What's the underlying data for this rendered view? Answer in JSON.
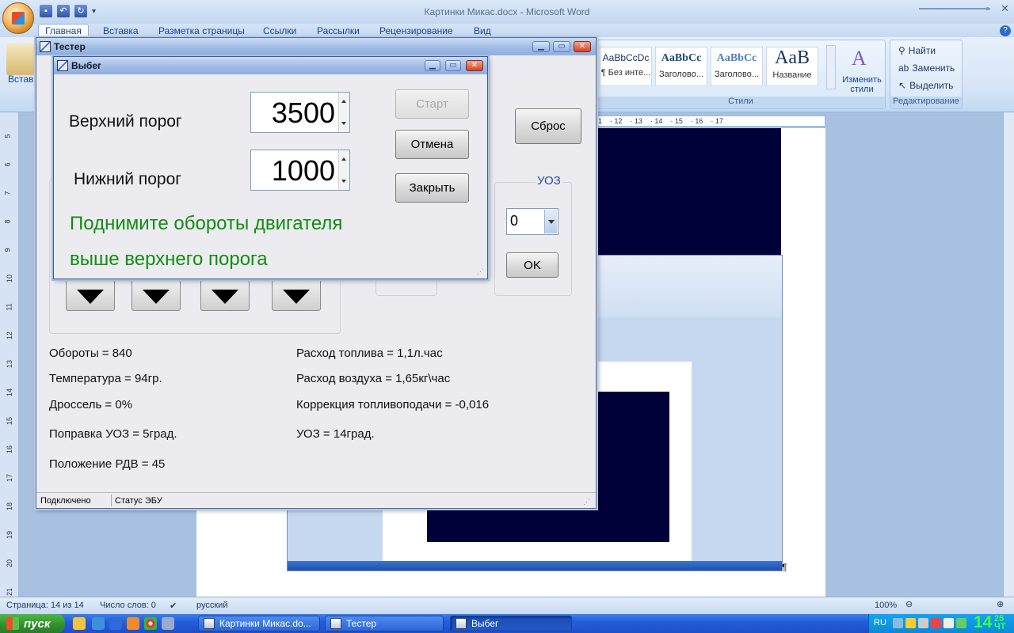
{
  "word": {
    "title": "Картинки Микас.docx - Microsoft Word",
    "tabs": [
      "Главная",
      "Вставка",
      "Разметка страницы",
      "Ссылки",
      "Рассылки",
      "Рецензирование",
      "Вид"
    ],
    "ribbon": {
      "paste_label": "Встави",
      "styles": [
        {
          "sample": "AaBbCcDc",
          "name": "¶ Без инте..."
        },
        {
          "sample": "AaBbCc",
          "name": "Заголово..."
        },
        {
          "sample": "AaBbCc",
          "name": "Заголово..."
        },
        {
          "sample": "AaB",
          "name": "Название"
        }
      ],
      "change_styles": "Изменить стили",
      "styles_group": "Стили",
      "find": "Найти",
      "replace": "Заменить",
      "select": "Выделить",
      "editing_group": "Редактирование"
    },
    "ruler": [
      "11",
      "12",
      "13",
      "14",
      "15",
      "16",
      "17"
    ],
    "vruler": [
      "5",
      "6",
      "7",
      "8",
      "9",
      "10",
      "11",
      "12",
      "13",
      "14",
      "15",
      "16",
      "17",
      "18",
      "19",
      "20",
      "21"
    ],
    "status": {
      "page": "Страница: 14 из 14",
      "words": "Число слов: 0",
      "lang": "русский",
      "zoom": "100%"
    }
  },
  "taskbar": {
    "start": "пуск",
    "items": [
      {
        "label": "Картинки Микас.do...",
        "active": false
      },
      {
        "label": "Тестер",
        "active": false
      },
      {
        "label": "Выбег",
        "active": true
      }
    ],
    "tray_lang": "RU",
    "clock_hour": "14",
    "clock_min": "25",
    "clock_day": "ЧТ"
  },
  "tester": {
    "title": "Тестер",
    "reset_button": "Сброс",
    "uoz_group": "УОЗ",
    "uoz_value": "0",
    "ok_button": "OK",
    "info_left": [
      "Обороты = 840",
      "Температура = 94гр.",
      "Дроссель = 0%",
      "Поправка УОЗ = 5град.",
      "Положение РДВ = 45"
    ],
    "info_right": [
      "Расход топлива = 1,1л.час",
      "Расход воздуха = 1,65кг\\час",
      "Коррекция топливоподачи = -0,016",
      "УОЗ = 14град."
    ],
    "status_connected": "Подключено",
    "status_ecu": "Статус ЭБУ"
  },
  "vybeg": {
    "title": "Выбег",
    "upper_label": "Верхний порог",
    "upper_value": "3500",
    "lower_label": "Нижний порог",
    "lower_value": "1000",
    "start_button": "Старт",
    "cancel_button": "Отмена",
    "close_button": "Закрыть",
    "message_line1": "Поднимите обороты двигателя",
    "message_line2": "выше верхнего порога"
  }
}
